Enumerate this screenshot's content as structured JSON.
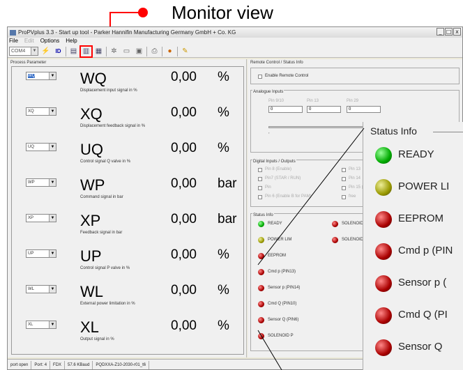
{
  "annotation": {
    "label": "Monitor view"
  },
  "window": {
    "title": "ProPVplus 3.3 - Start up tool  - Parker Hannifin Manufacturing Germany GmbH + Co. KG",
    "controls": [
      "_",
      "□",
      "x"
    ]
  },
  "menu": {
    "file": "File",
    "edit": "Edit",
    "options": "Options",
    "help": "Help"
  },
  "toolbar": {
    "port": "COM4"
  },
  "process": {
    "title": "Process Parameter",
    "rows": [
      {
        "select": "WQ",
        "name": "WQ",
        "desc": "Displacement input signal in %",
        "value": "0,00",
        "unit": "%"
      },
      {
        "select": "XQ",
        "name": "XQ",
        "desc": "Displacement feedback signal in %",
        "value": "0,00",
        "unit": "%"
      },
      {
        "select": "UQ",
        "name": "UQ",
        "desc": "Control signal Q valve in %",
        "value": "0,00",
        "unit": "%"
      },
      {
        "select": "WP",
        "name": "WP",
        "desc": "Command signal in bar",
        "value": "0,00",
        "unit": "bar"
      },
      {
        "select": "XP",
        "name": "XP",
        "desc": "Feedback signal in bar",
        "value": "0,00",
        "unit": "bar"
      },
      {
        "select": "UP",
        "name": "UP",
        "desc": "Control signal P valve in %",
        "value": "0,00",
        "unit": "%"
      },
      {
        "select": "WL",
        "name": "WL",
        "desc": "External power limitation in %",
        "value": "0,00",
        "unit": "%"
      },
      {
        "select": "XL",
        "name": "XL",
        "desc": "Output signal in %",
        "value": "0,00",
        "unit": "%"
      }
    ]
  },
  "remote": {
    "title": "Remote Control / Status Info",
    "enable": "Enable Remote Control"
  },
  "analogue": {
    "title": "Analogue Inputs",
    "pins": [
      {
        "label": "Pin 9/10",
        "value": "0"
      },
      {
        "label": "Pin 13",
        "value": "0"
      },
      {
        "label": "Pin 29",
        "value": "0"
      }
    ]
  },
  "digital": {
    "title": "Digital Inputs / Outputs",
    "left": [
      "Pin 8 (Enable)",
      "Pin7 (STAR / RUN)",
      "Pin",
      "Pin 6 (Enable B for PAM)"
    ],
    "right": [
      "Pin 13",
      "Pin 14",
      "Pin 15 (Ena",
      "free"
    ]
  },
  "status": {
    "title": "Status Info",
    "left": [
      {
        "label": "READY",
        "color": "green"
      },
      {
        "label": "POWER LIM",
        "color": "olive"
      },
      {
        "label": "EEPROM",
        "color": "red"
      },
      {
        "label": "Cmd p (PIN13)",
        "color": "red"
      },
      {
        "label": "Sensor p (PIN14)",
        "color": "red"
      },
      {
        "label": "Cmd Q (PIN10)",
        "color": "red"
      },
      {
        "label": "Sensor Q (PIN6)",
        "color": "red"
      },
      {
        "label": "SOLENOID P",
        "color": "red"
      }
    ],
    "right": [
      {
        "label": "SOLENOID",
        "color": "red"
      },
      {
        "label": "SOLENOID",
        "color": "red"
      }
    ]
  },
  "zoom": {
    "title": "Status Info",
    "items": [
      {
        "label": "READY",
        "color": "green"
      },
      {
        "label": "POWER LI",
        "color": "olive"
      },
      {
        "label": "EEPROM",
        "color": "red"
      },
      {
        "label": "Cmd p (PIN",
        "color": "red"
      },
      {
        "label": "Sensor p (",
        "color": "red"
      },
      {
        "label": "Cmd Q (PI",
        "color": "red"
      },
      {
        "label": "Sensor Q",
        "color": "red"
      }
    ]
  },
  "statusbar": [
    "port open",
    "Port: 4",
    "FDX",
    "57.6 KBaud",
    "PQDXXA-Z10-2030-r01_t6"
  ]
}
